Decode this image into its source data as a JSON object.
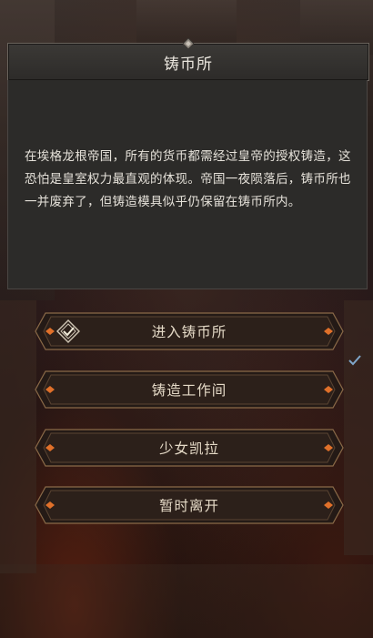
{
  "dialog": {
    "title": "铸币所",
    "description": "在埃格龙根帝国，所有的货币都需经过皇帝的授权铸造，这恐怕是皇室权力最直观的体现。帝国一夜陨落后，铸币所也一并废弃了，但铸造模具似乎仍保留在铸币所内。"
  },
  "options": [
    {
      "label": "进入铸币所",
      "checked": true
    },
    {
      "label": "铸造工作间",
      "checked": false
    },
    {
      "label": "少女凯拉",
      "checked": false
    },
    {
      "label": "暂时离开",
      "checked": false
    }
  ],
  "colors": {
    "frame_gold": "#b08a58",
    "gem_orange": "#e0702a",
    "text": "#e4d9c6"
  }
}
